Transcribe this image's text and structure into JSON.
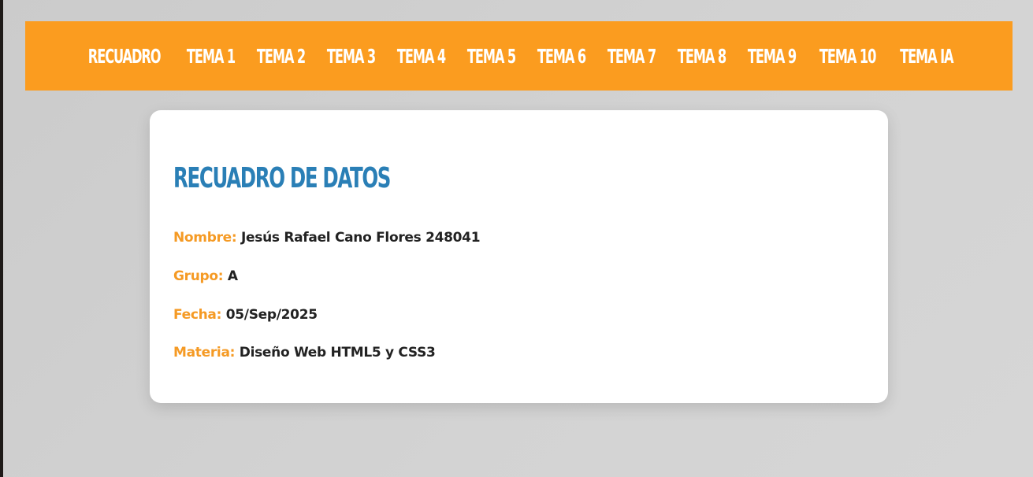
{
  "nav": {
    "items": [
      {
        "label": "RECUADRO"
      },
      {
        "label": "TEMA 1"
      },
      {
        "label": "TEMA 2"
      },
      {
        "label": "TEMA 3"
      },
      {
        "label": "TEMA 4"
      },
      {
        "label": "TEMA 5"
      },
      {
        "label": "TEMA 6"
      },
      {
        "label": "TEMA 7"
      },
      {
        "label": "TEMA 8"
      },
      {
        "label": "TEMA 9"
      },
      {
        "label": "TEMA 10"
      },
      {
        "label": "TEMA IA"
      }
    ]
  },
  "card": {
    "title": "RECUADRO DE DATOS",
    "fields": [
      {
        "label": "Nombre:",
        "value": "Jesús Rafael Cano Flores 248041"
      },
      {
        "label": "Grupo:",
        "value": "A"
      },
      {
        "label": "Fecha:",
        "value": "05/Sep/2025"
      },
      {
        "label": "Materia:",
        "value": "Diseño Web HTML5 y CSS3"
      }
    ]
  },
  "colors": {
    "nav_background": "#fb9c1f",
    "title": "#2a7fb6",
    "label": "#f59a24",
    "page_background": "#d0d0d0"
  }
}
